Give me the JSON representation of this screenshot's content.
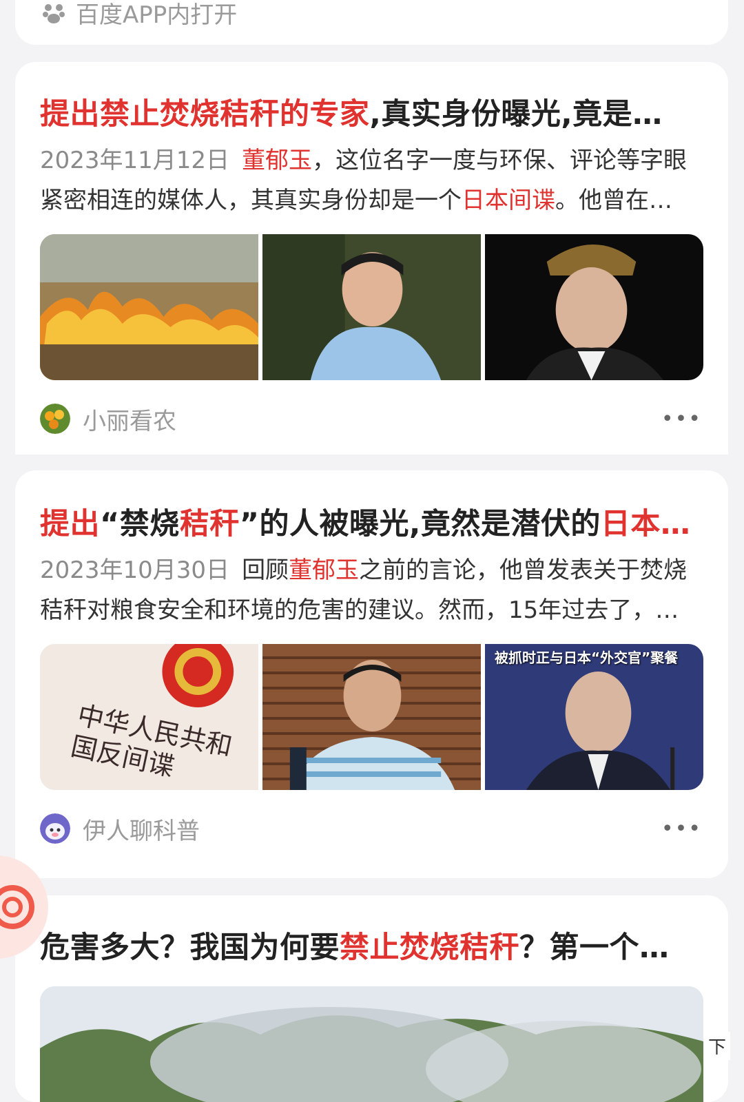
{
  "top_card": {
    "open_in_app": "百度APP内打开"
  },
  "articles": [
    {
      "title_parts": [
        {
          "text": "提出禁止焚烧秸秆的专家",
          "hl": true
        },
        {
          "text": ",真实身份曝光,竟是…",
          "hl": false
        }
      ],
      "date": "2023年11月12日",
      "summary_line1_parts": [
        {
          "text": "董郁玉",
          "hl": true
        },
        {
          "text": "，这位名字一度与环保、评论等字眼",
          "hl": false
        }
      ],
      "summary_line2_parts": [
        {
          "text": "紧密相连的媒体人，其真实身份却是一个",
          "hl": false
        },
        {
          "text": "日本间谍",
          "hl": true
        },
        {
          "text": "。他曾在…",
          "hl": false
        }
      ],
      "images": [
        "burning-field-image",
        "man-blue-shirt-image",
        "man-military-cap-image"
      ],
      "author": "小丽看农"
    },
    {
      "title_parts": [
        {
          "text": "提出",
          "hl": true
        },
        {
          "text": "“禁烧",
          "hl": false
        },
        {
          "text": "秸秆",
          "hl": true
        },
        {
          "text": "”的人被曝光,竟然是潜伏的",
          "hl": false
        },
        {
          "text": "日本…",
          "hl": true
        }
      ],
      "date": "2023年10月30日",
      "summary_line1_parts": [
        {
          "text": "回顾",
          "hl": false
        },
        {
          "text": "董郁玉",
          "hl": true
        },
        {
          "text": "之前的言论，他曾发表关于焚烧",
          "hl": false
        }
      ],
      "summary_line2_parts": [
        {
          "text": "秸秆对粮食安全和环境的危害的建议。然而，15年过去了，…",
          "hl": false
        }
      ],
      "images": [
        "counter-espionage-law-image",
        "man-striped-shirt-image",
        "man-press-conference-image"
      ],
      "image_caption": "被抓时正与日本“外交官”聚餐",
      "image_text": "中华人民共和国反间谍",
      "author": "伊人聊科普"
    },
    {
      "title_parts": [
        {
          "text": "危害多大？我国为何要",
          "hl": false
        },
        {
          "text": "禁止焚烧秸秆",
          "hl": true
        },
        {
          "text": "？第一个…",
          "hl": false
        }
      ]
    }
  ],
  "more_icon": "more-dots-icon",
  "float_icon": "baidu-float-icon",
  "bottom_label": "下",
  "colors": {
    "highlight": "#e0322e",
    "background": "#f3f3f5",
    "card": "#ffffff"
  }
}
